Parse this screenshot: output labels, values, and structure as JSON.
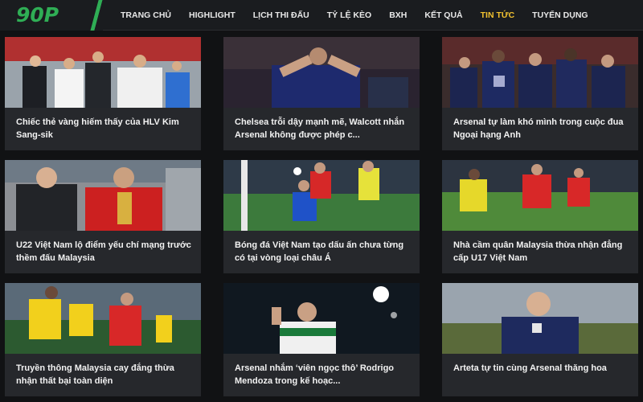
{
  "site": {
    "logo": "90P"
  },
  "nav": {
    "items": [
      {
        "label": "TRANG CHỦ",
        "active": false
      },
      {
        "label": "HIGHLIGHT",
        "active": false
      },
      {
        "label": "LỊCH THI ĐẤU",
        "active": false
      },
      {
        "label": "TỶ LỆ KÈO",
        "active": false
      },
      {
        "label": "BXH",
        "active": false
      },
      {
        "label": "KẾT QUẢ",
        "active": false
      },
      {
        "label": "TIN TỨC",
        "active": true
      },
      {
        "label": "TUYỂN DỤNG",
        "active": false
      }
    ],
    "active_color": "#f2c230"
  },
  "articles": [
    {
      "title": "Chiếc thẻ vàng hiếm thấy của HLV Kim Sang-sik"
    },
    {
      "title": "Chelsea trỗi dậy mạnh mẽ, Walcott nhắn Arsenal không được phép c..."
    },
    {
      "title": "Arsenal tự làm khó mình trong cuộc đua Ngoại hạng Anh"
    },
    {
      "title": "U22 Việt Nam lộ điểm yếu chí mạng trước thềm đấu Malaysia"
    },
    {
      "title": "Bóng đá Việt Nam tạo dấu ấn chưa từng có tại vòng loại châu Á"
    },
    {
      "title": "Nhà cầm quân Malaysia thừa nhận đẳng cấp U17 Việt Nam"
    },
    {
      "title": "Truyền thông Malaysia cay đắng thừa nhận thất bại toàn diện"
    },
    {
      "title": "Arsenal nhắm ‘viên ngọc thô’ Rodrigo Mendoza trong kế hoạc..."
    },
    {
      "title": "Arteta tự tin cùng Arsenal thăng hoa"
    }
  ],
  "colors": {
    "brand": "#2fae55",
    "card_bg": "#26282c",
    "page_bg": "#111214"
  }
}
